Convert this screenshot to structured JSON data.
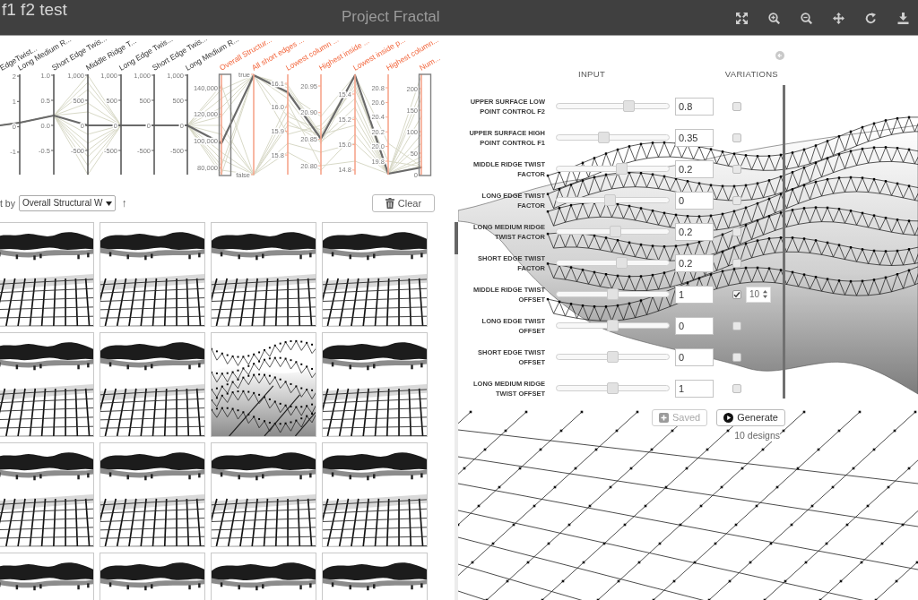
{
  "app_bar": {
    "project": "f1 f2 test",
    "title": "Project Fractal"
  },
  "parallel_coordinates": {
    "axes": [
      {
        "label": "EdgeTwist...",
        "kind": "input",
        "brushed": false
      },
      {
        "label": "Long Medium R...",
        "kind": "input",
        "brushed": false,
        "ticks": [
          "2",
          "1",
          "0",
          "-1"
        ]
      },
      {
        "label": "Short Edge Twis...",
        "kind": "input",
        "brushed": false,
        "ticks": [
          "1.0",
          "0.5",
          "0.0",
          "-0.5"
        ]
      },
      {
        "label": "Middle Ridge T...",
        "kind": "input",
        "brushed": false,
        "ticks": [
          "1,000",
          "500",
          "0",
          "-500"
        ]
      },
      {
        "label": "Long Edge Twis...",
        "kind": "input",
        "brushed": false,
        "ticks": [
          "1,000",
          "500",
          "0",
          "-500"
        ]
      },
      {
        "label": "Short Edge Twis...",
        "kind": "input",
        "brushed": false,
        "ticks": [
          "1,000",
          "500",
          "0",
          "-500"
        ]
      },
      {
        "label": "Long Medium R...",
        "kind": "input",
        "brushed": false,
        "ticks": [
          "1,000",
          "500",
          "0",
          "-500"
        ]
      },
      {
        "label": "Overall Structur...",
        "kind": "objective",
        "brushed": true,
        "ticks": [
          "140,000",
          "120,000",
          "100,000",
          "80,000"
        ]
      },
      {
        "label": "All short edges ...",
        "kind": "objective",
        "brushed": false,
        "ticks": [
          "true",
          "false"
        ]
      },
      {
        "label": "Lowest column ...",
        "kind": "objective",
        "brushed": false,
        "ticks": [
          "16.1",
          "16.0",
          "15.9",
          "15.8"
        ]
      },
      {
        "label": "Highest inside ...",
        "kind": "objective",
        "brushed": false,
        "ticks": [
          "20.95",
          "20.90",
          "20.85",
          "20.80"
        ]
      },
      {
        "label": "Lowest inside p...",
        "kind": "objective",
        "brushed": false,
        "ticks": [
          "15.4",
          "15.2",
          "15.0",
          "14.8"
        ]
      },
      {
        "label": "Highest column...",
        "kind": "objective",
        "brushed": false,
        "ticks": [
          "20.8",
          "20.6",
          "20.4",
          "20.2",
          "20.0",
          "19.8"
        ]
      },
      {
        "label": "Num...",
        "kind": "objective",
        "brushed": true,
        "ticks": [
          "200",
          "150",
          "100",
          "50",
          "0"
        ]
      }
    ]
  },
  "sort": {
    "label": "t by",
    "value": "Overall Structural W",
    "direction": "↑"
  },
  "clear_button": {
    "label": "Clear"
  },
  "thumbnails": [
    {
      "kind": "structure"
    },
    {
      "kind": "structure"
    },
    {
      "kind": "structure"
    },
    {
      "kind": "structure"
    },
    {
      "kind": "structure"
    },
    {
      "kind": "structure"
    },
    {
      "kind": "closeup"
    },
    {
      "kind": "structure"
    },
    {
      "kind": "structure"
    },
    {
      "kind": "structure"
    },
    {
      "kind": "structure"
    },
    {
      "kind": "structure"
    },
    {
      "kind": "structure"
    },
    {
      "kind": "structure"
    },
    {
      "kind": "structure"
    },
    {
      "kind": "structure"
    }
  ],
  "parameters": {
    "headers": [
      "INPUT",
      "VARIATIONS"
    ],
    "rows": [
      {
        "label": "UPPER SURFACE LOW POINT CONTROL F2",
        "level": 0.66,
        "value": "0.8",
        "checked": false
      },
      {
        "label": "UPPER SURFACE HIGH POINT CONTROL F1",
        "level": 0.41,
        "value": "0.35",
        "checked": false
      },
      {
        "label": "MIDDLE RIDGE TWIST FACTOR",
        "level": 0.59,
        "value": "0.2",
        "checked": false
      },
      {
        "label": "LONG EDGE TWIST FACTOR",
        "level": 0.47,
        "value": "0",
        "checked": false
      },
      {
        "label": "LONG MEDIUM RIDGE TWIST FACTOR",
        "level": 0.53,
        "value": "0.2",
        "checked": false
      },
      {
        "label": "SHORT EDGE TWIST FACTOR",
        "level": 0.59,
        "value": "0.2",
        "checked": false
      },
      {
        "label": "MIDDLE RIDGE TWIST OFFSET",
        "level": 0.5,
        "value": "1",
        "checked": true,
        "count": "10"
      },
      {
        "label": "LONG EDGE TWIST OFFSET",
        "level": 0.5,
        "value": "0",
        "checked": false
      },
      {
        "label": "SHORT EDGE TWIST OFFSET",
        "level": 0.5,
        "value": "0",
        "checked": false
      },
      {
        "label": "LONG MEDIUM RIDGE TWIST OFFSET",
        "level": 0.5,
        "value": "1",
        "checked": false
      }
    ]
  },
  "actions": [
    {
      "label": "Saved",
      "kind": "save",
      "disabled": true
    },
    {
      "label": "Generate",
      "kind": "generate",
      "disabled": false
    }
  ],
  "status": "10 designs"
}
